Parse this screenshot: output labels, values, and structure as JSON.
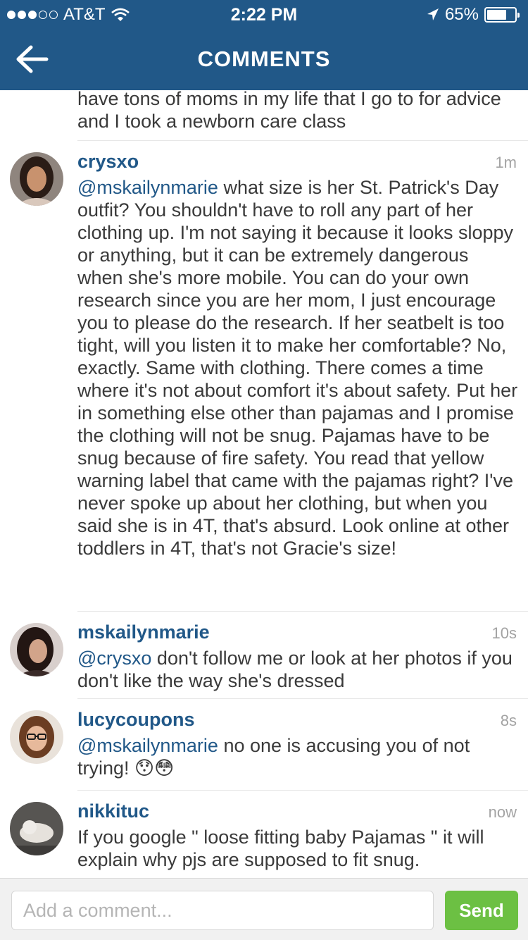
{
  "status": {
    "carrier": "AT&T",
    "time": "2:22 PM",
    "battery": "65%"
  },
  "nav": {
    "title": "COMMENTS"
  },
  "partial_comment": "have tons of moms in my life that I go to for advice and I took a newborn care class",
  "comments": [
    {
      "username": "crysxo",
      "time": "1m",
      "mention": "@mskailynmarie",
      "text": " what size is her St. Patrick's Day outfit? You shouldn't have to roll any part of her clothing up. I'm not saying it because it looks sloppy or anything, but it can be extremely dangerous when she's more mobile. You can do your own research since you are her mom, I just encourage you to please do the research. If her seatbelt is too tight, will you listen it to make her comfortable? No, exactly. Same with clothing. There comes a time where it's not about comfort it's about safety. Put her in something else other than pajamas and I promise the clothing will not be snug. Pajamas have to be snug because of fire safety. You read that yellow warning label that came with the pajamas right? I've never spoke up about her clothing, but when you said she is in 4T, that's absurd. Look online at other toddlers in 4T, that's not Gracie's size!"
    },
    {
      "username": "mskailynmarie",
      "time": "10s",
      "mention": "@crysxo",
      "text": " don't follow me or look at her photos if you don't like the way she's dressed"
    },
    {
      "username": "lucycoupons",
      "time": "8s",
      "mention": "@mskailynmarie",
      "text": " no one is accusing you of not trying! 😯😳"
    },
    {
      "username": "nikkituc",
      "time": "now",
      "mention": "",
      "text": "If you google \" loose fitting baby Pajamas \" it will explain why pjs are supposed to fit snug."
    }
  ],
  "composer": {
    "placeholder": "Add a comment...",
    "send_label": "Send"
  },
  "colors": {
    "header": "#215888",
    "link": "#215888",
    "send": "#6cc043"
  }
}
